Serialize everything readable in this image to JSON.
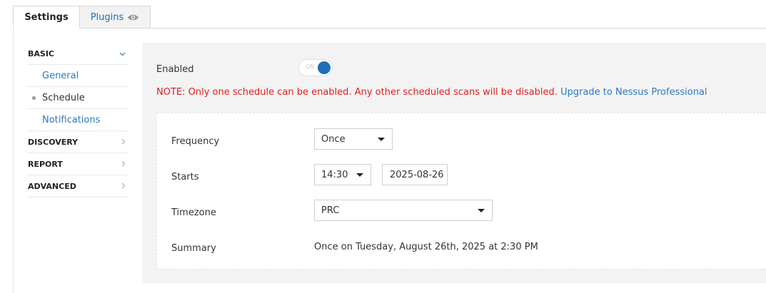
{
  "tabs": {
    "settings_label": "Settings",
    "plugins_label": "Plugins",
    "plugins_icon": "eye-icon"
  },
  "sidebar": {
    "basic": {
      "label": "BASIC",
      "icon": "chevron-down-icon",
      "items": [
        {
          "label": "General"
        },
        {
          "label": "Schedule"
        },
        {
          "label": "Notifications"
        }
      ]
    },
    "discovery_label": "DISCOVERY",
    "report_label": "REPORT",
    "advanced_label": "ADVANCED",
    "collapsed_icon": "chevron-right-icon"
  },
  "schedule": {
    "enabled_label": "Enabled",
    "toggle_text": "ON",
    "toggle_state": true,
    "note_text": "NOTE: Only one schedule can be enabled. Any other scheduled scans will be disabled.",
    "upgrade_link": "Upgrade to Nessus Professional",
    "frequency_label": "Frequency",
    "frequency_value": "Once",
    "starts_label": "Starts",
    "start_time": "14:30",
    "start_date": "2025-08-26",
    "timezone_label": "Timezone",
    "timezone_value": "PRC",
    "summary_label": "Summary",
    "summary_value": "Once on Tuesday, August 26th, 2025 at 2:30 PM"
  },
  "colors": {
    "link": "#2b79c2",
    "note": "#e02020",
    "toggle_on": "#1e6fb8",
    "panel_bg": "#f3f3f3"
  }
}
